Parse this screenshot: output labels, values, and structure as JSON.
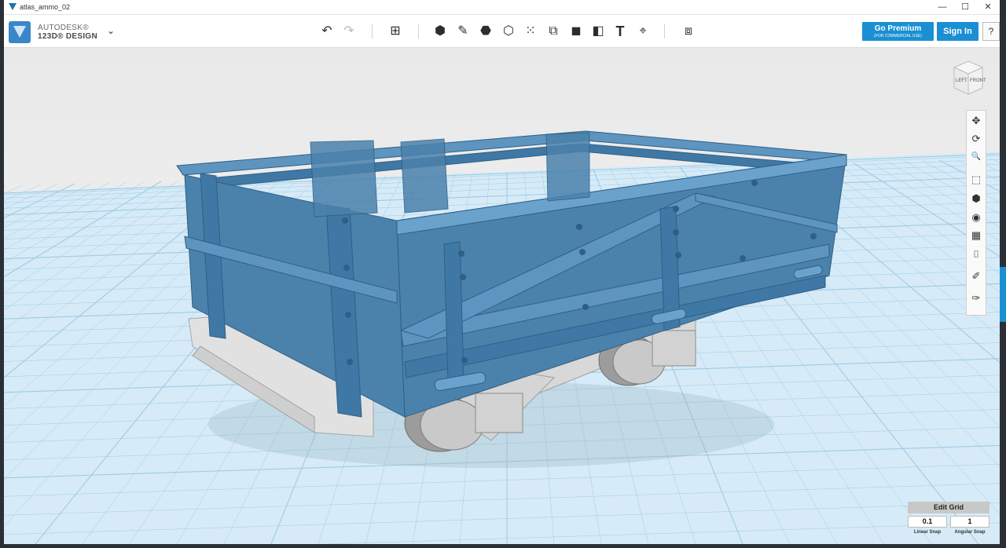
{
  "window": {
    "title": "atlas_ammo_02",
    "controls": {
      "minimize": "—",
      "maximize": "☐",
      "close": "✕"
    }
  },
  "brand": {
    "company": "AUTODESK®",
    "product": "123D® DESIGN",
    "menu_icon": "chevron-down-icon",
    "menu_glyph": "⌄"
  },
  "toolbar": {
    "undo_glyph": "↶",
    "redo_glyph": "↷",
    "tools": [
      {
        "name": "transform-icon",
        "glyph": "⊞"
      },
      {
        "name": "primitives-icon",
        "glyph": "⬢"
      },
      {
        "name": "sketch-icon",
        "glyph": "✎"
      },
      {
        "name": "construct-icon",
        "glyph": "⬣"
      },
      {
        "name": "modify-icon",
        "glyph": "⬡"
      },
      {
        "name": "pattern-icon",
        "glyph": "⁙"
      },
      {
        "name": "grouping-icon",
        "glyph": "⧉"
      },
      {
        "name": "combine-icon",
        "glyph": "◼"
      },
      {
        "name": "measure-icon",
        "glyph": "◧"
      },
      {
        "name": "text-icon",
        "glyph": "T"
      },
      {
        "name": "snap-icon",
        "glyph": "⌖"
      },
      {
        "name": "material-icon",
        "glyph": "⧈"
      }
    ],
    "premium_label": "Go Premium",
    "premium_sub": "(FOR COMMERCIAL USE)",
    "signin_label": "Sign In",
    "help_label": "?"
  },
  "viewcube": {
    "left": "LEFT",
    "front": "FRONT"
  },
  "navbar": [
    {
      "name": "pan-icon",
      "glyph": "✥"
    },
    {
      "name": "orbit-icon",
      "glyph": "⟳"
    },
    {
      "name": "zoom-icon",
      "glyph": "🔍"
    },
    {
      "name": "fit-icon",
      "glyph": "⬚"
    },
    {
      "name": "views-icon",
      "glyph": "⬢"
    },
    {
      "name": "visibility-icon",
      "glyph": "◉"
    },
    {
      "name": "materials-icon",
      "glyph": "▦"
    },
    {
      "name": "camera-icon",
      "glyph": "⌷"
    },
    {
      "name": "show-icon",
      "glyph": "✐"
    },
    {
      "name": "hide-icon",
      "glyph": "✑"
    }
  ],
  "grid": {
    "edit_label": "Edit Grid",
    "linear_snap_value": "0.1",
    "angular_snap_value": "1",
    "linear_snap_label": "Linear Snap",
    "angular_snap_label": "Angular Snap"
  },
  "colors": {
    "accent": "#1b8fd3",
    "model": "#4b82ac",
    "model_dark": "#2f5f86",
    "grid_line": "#9fcbe6",
    "floor": "#cfe6f3"
  }
}
